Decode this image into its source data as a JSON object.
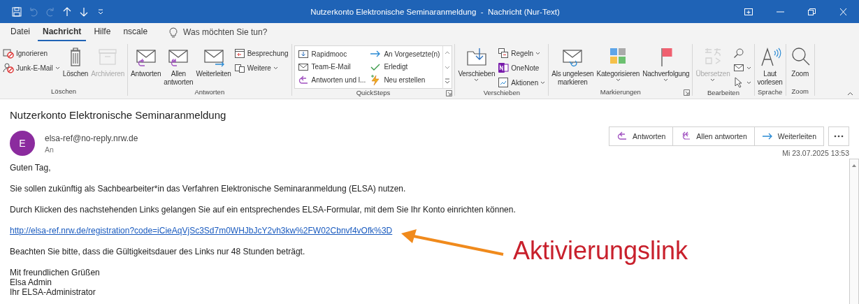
{
  "window": {
    "title": "Nutzerkonto Elektronische Seminaranmeldung  -  Nachricht (Nur-Text)"
  },
  "quick_access": [
    {
      "disabled": false
    },
    {
      "disabled": true
    },
    {
      "disabled": true
    },
    {
      "disabled": false
    },
    {
      "disabled": false
    },
    {
      "disabled": false
    }
  ],
  "tabs": [
    {
      "label": "Datei",
      "selected": false
    },
    {
      "label": "Nachricht",
      "selected": true
    },
    {
      "label": "Hilfe",
      "selected": false
    },
    {
      "label": "nscale",
      "selected": false
    }
  ],
  "tell_me": {
    "placeholder": "Was möchten Sie tun?"
  },
  "ribbon": {
    "groups": [
      {
        "label": "Löschen",
        "launcher": false,
        "items": [
          {
            "kind": "small",
            "label": "Ignorieren",
            "dropdown": false,
            "disabled": false
          },
          {
            "kind": "small",
            "label": "Junk-E-Mail",
            "dropdown": true,
            "disabled": false
          },
          {
            "kind": "large",
            "lines": [
              "Löschen"
            ],
            "dropdown": false,
            "disabled": false
          },
          {
            "kind": "large",
            "lines": [
              "Archivieren"
            ],
            "dropdown": false,
            "disabled": true
          }
        ]
      },
      {
        "label": "Antworten",
        "launcher": false,
        "items": [
          {
            "kind": "large",
            "lines": [
              "Antworten"
            ],
            "dropdown": false,
            "disabled": false
          },
          {
            "kind": "large",
            "lines": [
              "Allen",
              "antworten"
            ],
            "dropdown": false,
            "disabled": false
          },
          {
            "kind": "large",
            "lines": [
              "Weiterleiten"
            ],
            "dropdown": false,
            "disabled": false
          },
          {
            "kind": "small",
            "label": "Besprechung",
            "dropdown": false,
            "disabled": false
          },
          {
            "kind": "small",
            "label": "Weitere",
            "dropdown": true,
            "disabled": false
          }
        ]
      },
      {
        "label": "QuickSteps",
        "launcher": true,
        "items": [
          {
            "kind": "gallery",
            "entries": [
              {
                "label": "Rapidmooc"
              },
              {
                "label": "An Vorgesetzte(n)"
              },
              {
                "label": "Team-E-Mail"
              },
              {
                "label": "Erledigt"
              },
              {
                "label": "Antworten und l..."
              },
              {
                "label": "Neu erstellen"
              }
            ]
          }
        ]
      },
      {
        "label": "Verschieben",
        "launcher": false,
        "items": [
          {
            "kind": "large",
            "lines": [
              "Verschieben"
            ],
            "dropdown": true,
            "disabled": false
          },
          {
            "kind": "small",
            "label": "Regeln",
            "dropdown": true,
            "disabled": false
          },
          {
            "kind": "small",
            "label": "OneNote",
            "dropdown": false,
            "disabled": false
          },
          {
            "kind": "small",
            "label": "Aktionen",
            "dropdown": true,
            "disabled": false
          }
        ]
      },
      {
        "label": "Markierungen",
        "launcher": true,
        "items": [
          {
            "kind": "large",
            "lines": [
              "Als ungelesen",
              "markieren"
            ],
            "dropdown": false,
            "disabled": false
          },
          {
            "kind": "large",
            "lines": [
              "Kategorisieren"
            ],
            "dropdown": true,
            "disabled": false
          },
          {
            "kind": "large",
            "lines": [
              "Nachverfolgung"
            ],
            "dropdown": true,
            "disabled": false
          }
        ]
      },
      {
        "label": "Bearbeiten",
        "launcher": false,
        "items": [
          {
            "kind": "large",
            "lines": [
              "Übersetzen"
            ],
            "dropdown": true,
            "disabled": true
          },
          {
            "kind": "small",
            "dropdown": false,
            "disabled": false
          },
          {
            "kind": "small",
            "dropdown": true,
            "disabled": false
          },
          {
            "kind": "small",
            "dropdown": true,
            "disabled": false
          }
        ]
      },
      {
        "label": "Sprache",
        "launcher": false,
        "items": [
          {
            "kind": "large",
            "lines": [
              "Laut",
              "vorlesen"
            ],
            "dropdown": false,
            "disabled": false
          }
        ]
      },
      {
        "label": "Zoom",
        "launcher": false,
        "items": [
          {
            "kind": "large",
            "lines": [
              "Zoom"
            ],
            "dropdown": false,
            "disabled": false
          }
        ]
      }
    ]
  },
  "message": {
    "subject": "Nutzerkonto Elektronische Seminaranmeldung",
    "sender_initial": "E",
    "sender": "elsa-ref@no-reply.nrw.de",
    "to_label": "An",
    "actions": [
      "Antworten",
      "Allen antworten",
      "Weiterleiten"
    ],
    "date": "Mi 23.07.2025 13:53",
    "body": [
      {
        "kind": "text",
        "text": "Guten Tag,"
      },
      {
        "kind": "text",
        "text": "Sie sollen zukünftig als Sachbearbeiter*in das Verfahren Elektronische Seminaranmeldung (ELSA) nutzen."
      },
      {
        "kind": "text",
        "text": "Durch Klicken des nachstehenden Links gelangen Sie auf ein entsprechendes ELSA-Formular, mit dem Sie Ihr Konto einrichten können."
      },
      {
        "kind": "link",
        "text": "http://elsa-ref.nrw.de/registration?code=iCieAqVjSc3Sd7m0WHJbJcY2vh3kw%2FW02Cbnvf4vOfk%3D"
      },
      {
        "kind": "text",
        "text": "Beachten Sie bitte, dass die Gültigkeitsdauer des Links nur 48 Stunden beträgt."
      },
      {
        "kind": "lines",
        "lines": [
          "Mit freundlichen Grüßen",
          "Elsa Admin",
          "Ihr ELSA-Administrator"
        ]
      }
    ]
  },
  "annotation": {
    "text": "Aktivierungslink"
  }
}
